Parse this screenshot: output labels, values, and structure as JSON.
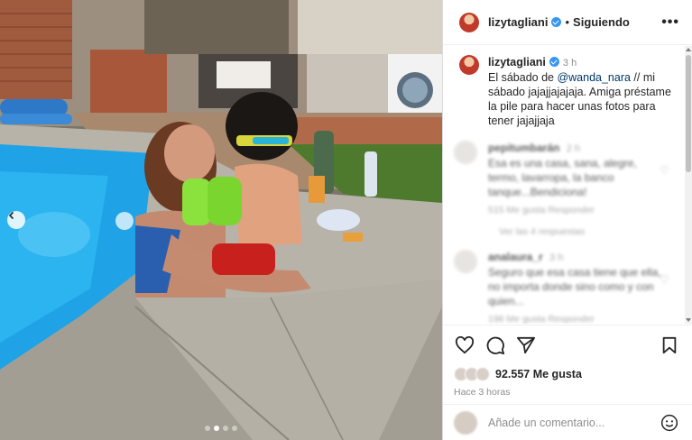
{
  "post": {
    "username": "lizytagliani",
    "follow_status": "Siguiendo",
    "more_label": "•••"
  },
  "caption": {
    "username": "lizytagliani",
    "text_before": "El sábado de ",
    "mention": "@wanda_nara",
    "text_after": " // mi sábado jajajjajajaja. Amiga préstame la pile para hacer unas fotos para tener jajajjaja",
    "time": "3 h"
  },
  "comments": [
    {
      "username": "pepitumbarán",
      "time": "2 h",
      "text": "Esa es una casa, sana, alegre, termo, lavarropa, la banco tanque...Bendiciona!",
      "meta": "515 Me gusta   Responder",
      "replies": "Ver las 4 respuestas"
    },
    {
      "username": "analaura_r",
      "time": "3 h",
      "text": "Seguro que esa casa tiene que ella, no importa donde sino como y con quien...",
      "meta": "198 Me gusta   Responder",
      "replies": ""
    }
  ],
  "likes": {
    "count": "92.557",
    "label": "Me gusta"
  },
  "posted_ago": "Hace 3 horas",
  "comment_input": {
    "placeholder": "Añade un comentario..."
  },
  "carousel": {
    "slides": 4,
    "active_index": 1
  },
  "colors": {
    "verified": "#3897f0",
    "mention": "#00376b",
    "pool_water": "#1fa3e6"
  }
}
